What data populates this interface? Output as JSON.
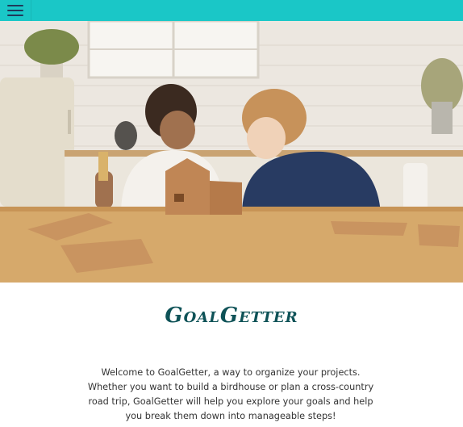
{
  "colors": {
    "accent": "#1ac7c7",
    "title": "#0e5257",
    "text": "#333333",
    "menu_icon": "#1f3a5a"
  },
  "header": {
    "menu_icon": "hamburger-menu-icon"
  },
  "hero": {
    "description_icon": "photo-children-building-gingerbread-house"
  },
  "main": {
    "title": "GoalGetter",
    "intro": "Welcome to GoalGetter, a way to organize your projects. Whether you want to build a birdhouse or plan a cross-country road trip, GoalGetter will help you explore your goals and help you break them down into manageable steps!"
  }
}
